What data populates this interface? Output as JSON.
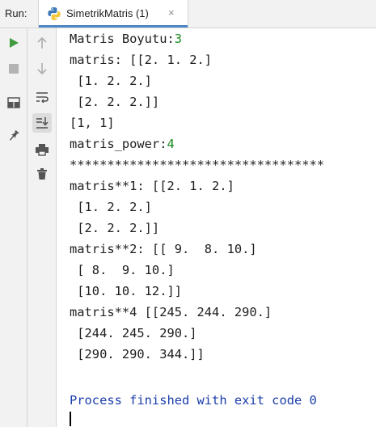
{
  "run_label": "Run:",
  "tab": {
    "title": "SimetrikMatris (1)",
    "close": "×"
  },
  "toolbar_left": [
    {
      "name": "run-icon"
    },
    {
      "name": "stop-icon"
    },
    {
      "name": "layout-icon"
    },
    {
      "name": "pin-icon"
    }
  ],
  "toolbar_right": [
    {
      "name": "arrow-up-icon"
    },
    {
      "name": "arrow-down-icon"
    },
    {
      "name": "soft-wrap-icon"
    },
    {
      "name": "scroll-to-end-icon"
    },
    {
      "name": "print-icon"
    },
    {
      "name": "trash-icon"
    }
  ],
  "console": {
    "lines": [
      {
        "text": "Matris Boyutu:",
        "input": "3"
      },
      {
        "text": "matris: [[2. 1. 2.]"
      },
      {
        "text": " [1. 2. 2.]"
      },
      {
        "text": " [2. 2. 2.]]"
      },
      {
        "text": "[1, 1]"
      },
      {
        "text": "matris_power:",
        "input": "4"
      },
      {
        "text": "**********************************"
      },
      {
        "text": "matris**1: [[2. 1. 2.]"
      },
      {
        "text": " [1. 2. 2.]"
      },
      {
        "text": " [2. 2. 2.]]"
      },
      {
        "text": "matris**2: [[ 9.  8. 10.]"
      },
      {
        "text": " [ 8.  9. 10.]"
      },
      {
        "text": " [10. 10. 12.]]"
      },
      {
        "text": "matris**4 [[245. 244. 290.]"
      },
      {
        "text": " [244. 245. 290.]"
      },
      {
        "text": " [290. 290. 344.]]"
      },
      {
        "text": ""
      },
      {
        "text": "Process finished with exit code 0",
        "kind": "process"
      }
    ]
  },
  "colors": {
    "input": "#178a1e",
    "process": "#1a3dab",
    "run": "#3f9b3f",
    "accent": "#4a88c7"
  }
}
